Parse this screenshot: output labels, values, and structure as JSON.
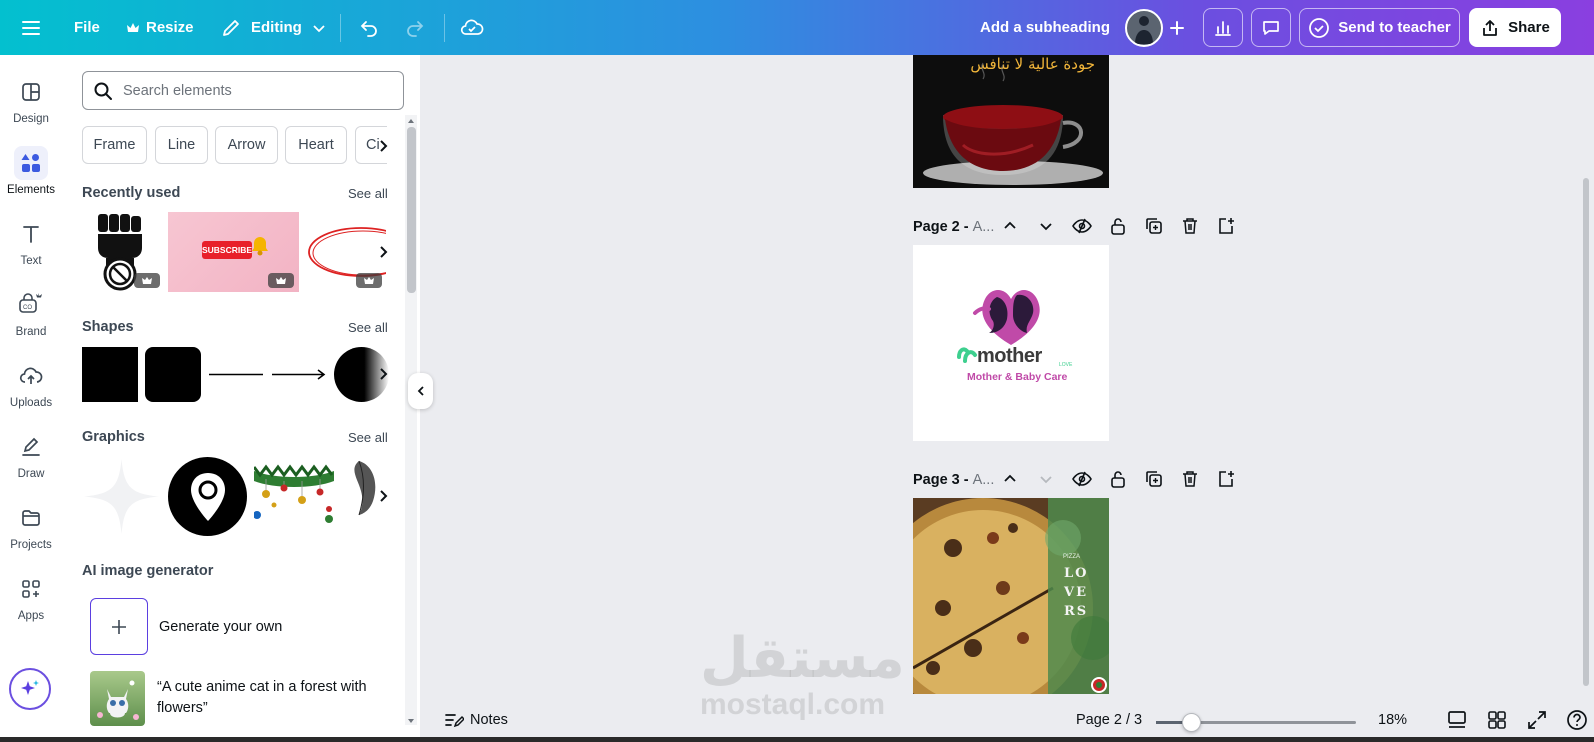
{
  "topbar": {
    "file": "File",
    "resize": "Resize",
    "editing": "Editing",
    "subheading": "Add a subheading",
    "send_to_teacher": "Send to teacher",
    "share": "Share"
  },
  "rail": {
    "items": [
      {
        "label": "Design"
      },
      {
        "label": "Elements"
      },
      {
        "label": "Text"
      },
      {
        "label": "Brand"
      },
      {
        "label": "Uploads"
      },
      {
        "label": "Draw"
      },
      {
        "label": "Projects"
      },
      {
        "label": "Apps"
      }
    ]
  },
  "panel": {
    "search_placeholder": "Search elements",
    "chips": [
      "Frame",
      "Line",
      "Arrow",
      "Heart",
      "Ci"
    ],
    "recently_used": "Recently used",
    "shapes": "Shapes",
    "graphics": "Graphics",
    "see_all": "See all",
    "subscribe_label": "SUBSCRIBE",
    "ai_title": "AI image generator",
    "generate_own": "Generate your own",
    "ai_prompt": "“A cute anime cat in a forest with flowers”"
  },
  "canvas": {
    "page1_arabic_text": "جودة عالية لا تنافس",
    "page2_title": "Page 2 -",
    "page2_name": "A...",
    "page3_title": "Page 3 -",
    "page3_name": "A...",
    "logo_brand": "mother",
    "logo_love": "LOVE",
    "logo_tagline": "Mother & Baby Care",
    "pizza_small": "PIZZA",
    "pizza_line1": "LO",
    "pizza_line2": "VE",
    "pizza_line3": "RS"
  },
  "watermark": {
    "arabic": "مستقل",
    "latin": "mostaql.com"
  },
  "bottombar": {
    "notes": "Notes",
    "page_indicator": "Page 2 / 3",
    "zoom": "18%",
    "zoom_fraction": 0.18
  }
}
